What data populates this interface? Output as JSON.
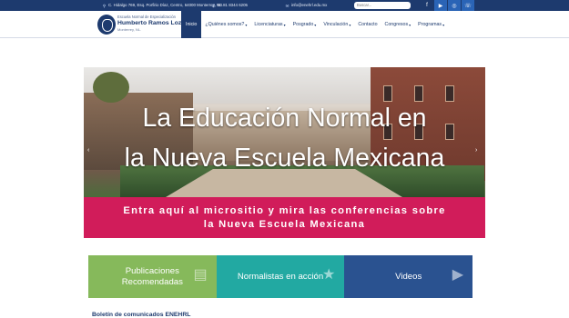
{
  "topbar": {
    "address": "C. Hidalgo 769, Esq. Porfirio Díaz, Centro, 64000 Monterrey, NL.",
    "phone": "00 81 8344 6205",
    "email": "info@enehrl.edu.mx",
    "search_placeholder": "Buscar...",
    "social": [
      "facebook-icon",
      "youtube-icon",
      "instagram-icon",
      "whatsapp-icon"
    ]
  },
  "header": {
    "logo_line1": "Escuela Normal de Especialización",
    "logo_line2": "Humberto Ramos Lozano",
    "logo_line3": "Monterrey, NL.",
    "nav": [
      {
        "label": "Inicio",
        "active": true,
        "dropdown": false
      },
      {
        "label": "¿Quiénes somos?",
        "active": false,
        "dropdown": true
      },
      {
        "label": "Licenciaturas",
        "active": false,
        "dropdown": true
      },
      {
        "label": "Posgrado",
        "active": false,
        "dropdown": true
      },
      {
        "label": "Vinculación",
        "active": false,
        "dropdown": true
      },
      {
        "label": "Contacto",
        "active": false,
        "dropdown": false
      },
      {
        "label": "Congresos",
        "active": false,
        "dropdown": true
      },
      {
        "label": "Programas",
        "active": false,
        "dropdown": true
      }
    ]
  },
  "hero": {
    "line1": "La Educación Normal en",
    "line2": "la Nueva Escuela Mexicana",
    "prev": "‹",
    "next": "›"
  },
  "banner": {
    "line1": "Entra aquí al micrositio y mira las conferencias sobre",
    "line2": "la Nueva Escuela Mexicana"
  },
  "tiles": [
    {
      "label": "Publicaciones Recomendadas",
      "icon": "document-icon"
    },
    {
      "label": "Normalistas en acción",
      "icon": "star-icon"
    },
    {
      "label": "Videos",
      "icon": "video-camera-icon"
    }
  ],
  "bulletin": {
    "title": "Boletín de comunicados ENEHRL"
  },
  "colors": {
    "navy": "#1d3a6e",
    "magenta": "#d11c5a",
    "green": "#86b95b",
    "teal": "#22a9a2",
    "blue": "#2a5290"
  }
}
